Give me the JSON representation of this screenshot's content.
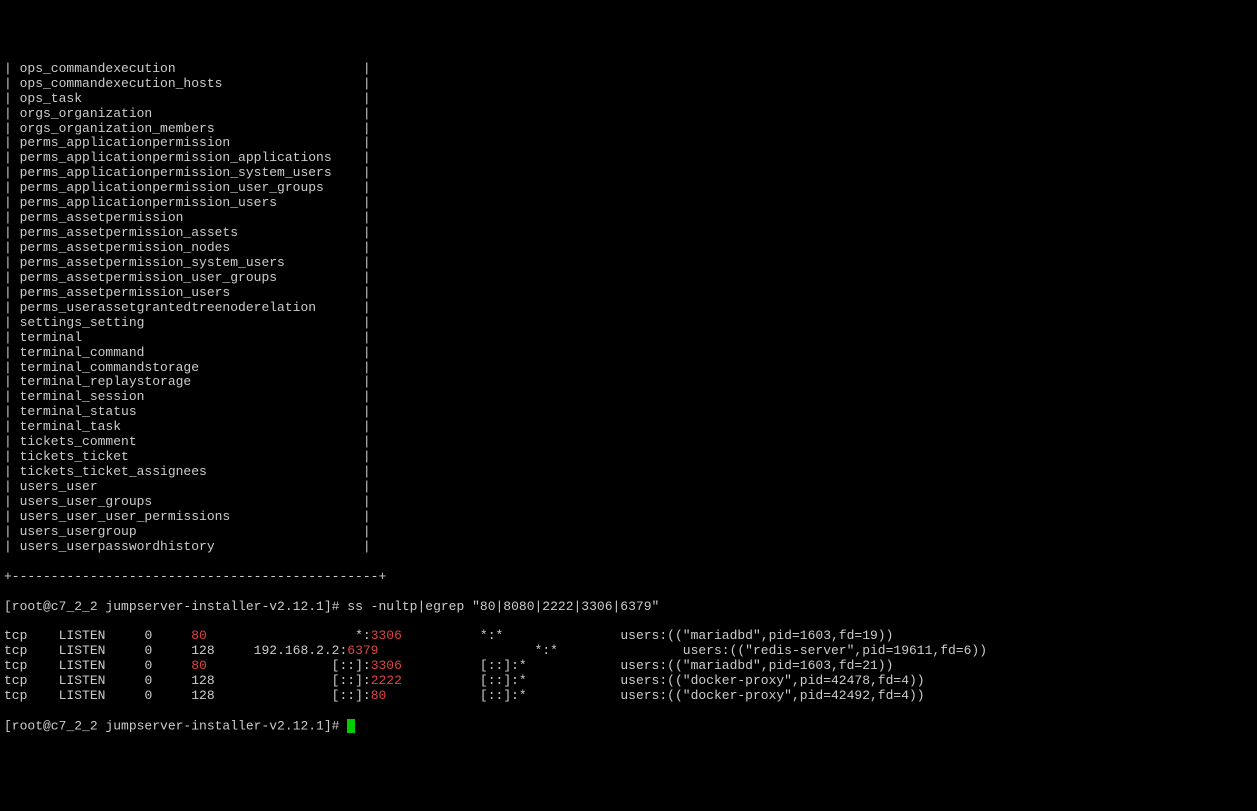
{
  "tables": [
    "ops_commandexecution",
    "ops_commandexecution_hosts",
    "ops_task",
    "orgs_organization",
    "orgs_organization_members",
    "perms_applicationpermission",
    "perms_applicationpermission_applications",
    "perms_applicationpermission_system_users",
    "perms_applicationpermission_user_groups",
    "perms_applicationpermission_users",
    "perms_assetpermission",
    "perms_assetpermission_assets",
    "perms_assetpermission_nodes",
    "perms_assetpermission_system_users",
    "perms_assetpermission_user_groups",
    "perms_assetpermission_users",
    "perms_userassetgrantedtreenoderelation",
    "settings_setting",
    "terminal",
    "terminal_command",
    "terminal_commandstorage",
    "terminal_replaystorage",
    "terminal_session",
    "terminal_status",
    "terminal_task",
    "tickets_comment",
    "tickets_ticket",
    "tickets_ticket_assignees",
    "users_user",
    "users_user_groups",
    "users_user_user_permissions",
    "users_usergroup",
    "users_userpasswordhistory"
  ],
  "separator": "+-----------------------------------------------+",
  "prompt1": {
    "user_host": "[root@c7_2_2 jumpserver-installer-v2.12.1]# ",
    "command": "ss -nultp|egrep \"80|8080|2222|3306|6379\""
  },
  "ss_output": [
    {
      "netid": "tcp",
      "state": "LISTEN",
      "recv": "0",
      "send": "80",
      "local_addr": "*:",
      "local_port": "3306",
      "peer": "*:*",
      "users": "users:((\"mariadbd\",pid=1603,fd=19))",
      "send_red": true,
      "port_red": true
    },
    {
      "netid": "tcp",
      "state": "LISTEN",
      "recv": "0",
      "send": "128",
      "local_addr": "192.168.2.2:",
      "local_port": "6379",
      "peer": "*:*",
      "users": "users:((\"redis-server\",pid=19611,fd=6))",
      "send_red": false,
      "port_red": true
    },
    {
      "netid": "tcp",
      "state": "LISTEN",
      "recv": "0",
      "send": "80",
      "local_addr": "[::]:",
      "local_port": "3306",
      "peer": "[::]:*",
      "users": "users:((\"mariadbd\",pid=1603,fd=21))",
      "send_red": true,
      "port_red": true
    },
    {
      "netid": "tcp",
      "state": "LISTEN",
      "recv": "0",
      "send": "128",
      "local_addr": "[::]:",
      "local_port": "2222",
      "peer": "[::]:*",
      "users": "users:((\"docker-proxy\",pid=42478,fd=4))",
      "send_red": false,
      "port_red": true
    },
    {
      "netid": "tcp",
      "state": "LISTEN",
      "recv": "0",
      "send": "128",
      "local_addr": "[::]:",
      "local_port": "80",
      "peer": "[::]:*",
      "users": "users:((\"docker-proxy\",pid=42492,fd=4))",
      "send_red": false,
      "port_red": true
    }
  ],
  "prompt2": {
    "user_host": "[root@c7_2_2 jumpserver-installer-v2.12.1]# "
  },
  "pipe": "| ",
  "pipe_end": "|"
}
